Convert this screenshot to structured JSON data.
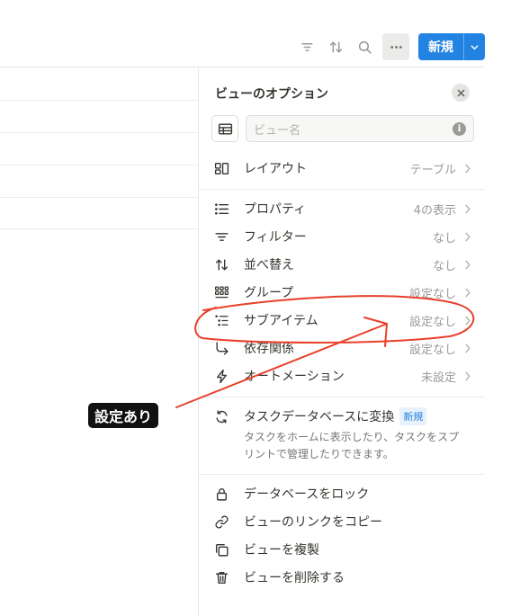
{
  "toolbar": {
    "icons": [
      "filter-icon",
      "sort-icon",
      "search-icon",
      "more-icon"
    ],
    "new_button": "新規"
  },
  "panel": {
    "title": "ビューのオプション",
    "name_placeholder": "ビュー名",
    "layout": {
      "label": "レイアウト",
      "value": "テーブル"
    },
    "items": [
      {
        "label": "プロパティ",
        "value": "4の表示",
        "icon": "list-icon"
      },
      {
        "label": "フィルター",
        "value": "なし",
        "icon": "filter-icon"
      },
      {
        "label": "並べ替え",
        "value": "なし",
        "icon": "sort-icon"
      },
      {
        "label": "グループ",
        "value": "設定なし",
        "icon": "group-icon"
      },
      {
        "label": "サブアイテム",
        "value": "設定なし",
        "icon": "subitems-icon"
      },
      {
        "label": "依存関係",
        "value": "設定なし",
        "icon": "dependency-icon"
      },
      {
        "label": "オートメーション",
        "value": "未設定",
        "icon": "bolt-icon"
      }
    ],
    "convert": {
      "title": "タスクデータベースに変換",
      "badge": "新規",
      "description": "タスクをホームに表示したり、タスクをスプリントで管理したりできます。"
    },
    "actions": [
      {
        "label": "データベースをロック",
        "icon": "lock-icon"
      },
      {
        "label": "ビューのリンクをコピー",
        "icon": "link-icon"
      },
      {
        "label": "ビューを複製",
        "icon": "duplicate-icon"
      },
      {
        "label": "ビューを削除する",
        "icon": "trash-icon"
      }
    ]
  },
  "annotation": {
    "label": "設定あり",
    "color": "#e8402a"
  }
}
